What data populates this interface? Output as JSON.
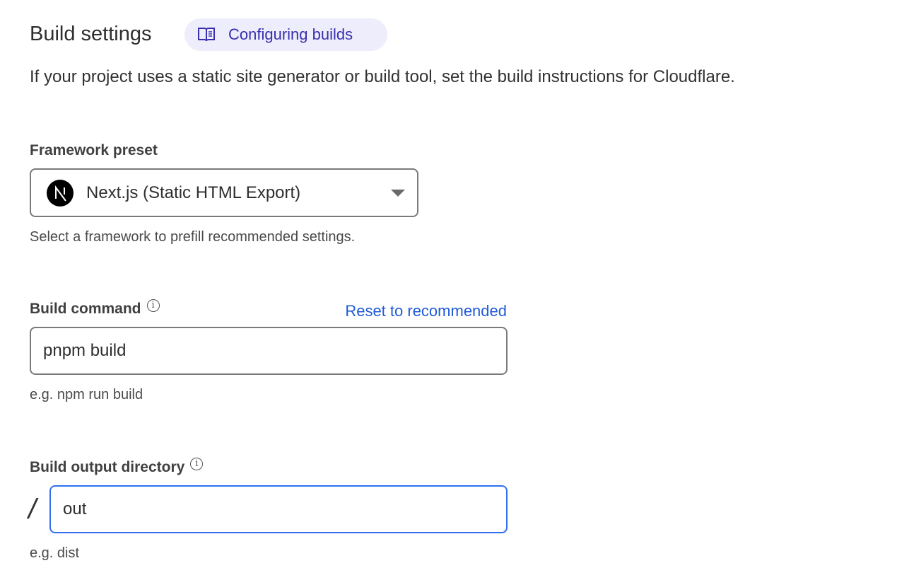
{
  "header": {
    "title": "Build settings",
    "docs_link": "Configuring builds",
    "description": "If your project uses a static site generator or build tool, set the build instructions for Cloudflare."
  },
  "framework": {
    "label": "Framework preset",
    "selected": "Next.js (Static HTML Export)",
    "help": "Select a framework to prefill recommended settings.",
    "icon": "nextjs-logo"
  },
  "build_command": {
    "label": "Build command",
    "reset": "Reset to recommended",
    "value": "pnpm build",
    "help": "e.g. npm run build"
  },
  "output_dir": {
    "label": "Build output directory",
    "prefix": "/",
    "value": "out",
    "help": "e.g. dist"
  },
  "colors": {
    "accent": "#1f5bd6",
    "focus": "#2f6ff0",
    "pill_bg": "#eeedfb",
    "pill_text": "#3a2fb0"
  }
}
